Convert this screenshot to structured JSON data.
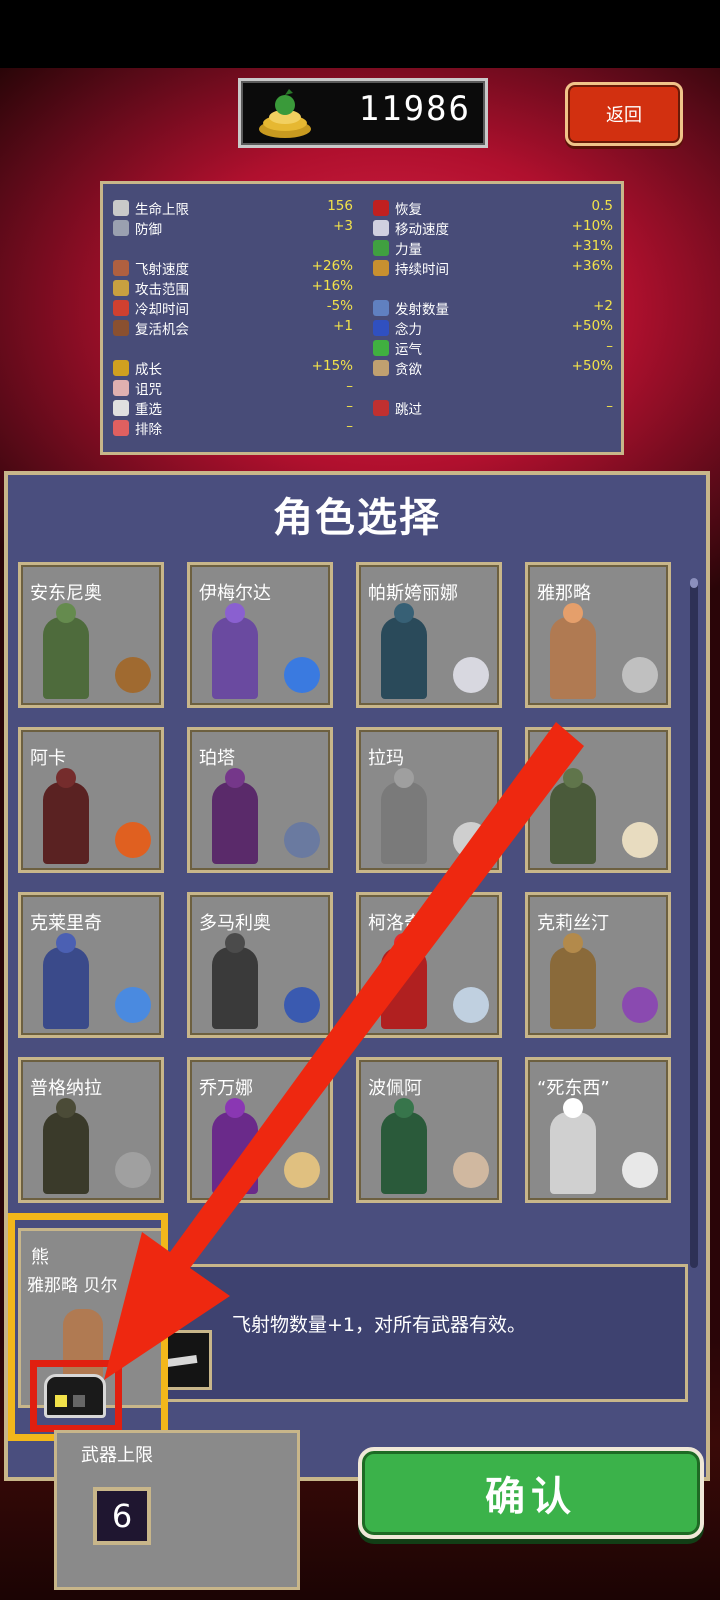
{
  "header": {
    "coins": "11986",
    "back_label": "返回"
  },
  "stats": {
    "left": [
      {
        "label": "生命上限",
        "value": "156",
        "icon": "heart-icon",
        "color": "#c9c9c9"
      },
      {
        "label": "防御",
        "value": "+3",
        "icon": "armor-icon",
        "color": "#9aa0b0"
      },
      {
        "label": "飞射速度",
        "value": "+26%",
        "icon": "speed-book-icon",
        "color": "#b06040"
      },
      {
        "label": "攻击范围",
        "value": "+16%",
        "icon": "area-icon",
        "color": "#c8a040"
      },
      {
        "label": "冷却时间",
        "value": "-5%",
        "icon": "cooldown-icon",
        "color": "#d04030"
      },
      {
        "label": "复活机会",
        "value": "+1",
        "icon": "revival-icon",
        "color": "#8a5030"
      },
      {
        "label": "成长",
        "value": "+15%",
        "icon": "growth-icon",
        "color": "#d0a020"
      },
      {
        "label": "诅咒",
        "value": "–",
        "icon": "curse-icon",
        "color": "#e0b0b0"
      },
      {
        "label": "重选",
        "value": "–",
        "icon": "reroll-icon",
        "color": "#e0e0e0"
      },
      {
        "label": "排除",
        "value": "–",
        "icon": "banish-icon",
        "color": "#e06060"
      }
    ],
    "right": [
      {
        "label": "恢复",
        "value": "0.5",
        "icon": "recovery-icon",
        "color": "#c02020"
      },
      {
        "label": "移动速度",
        "value": "+10%",
        "icon": "wings-icon",
        "color": "#d0d0e0"
      },
      {
        "label": "力量",
        "value": "+31%",
        "icon": "might-icon",
        "color": "#40a040"
      },
      {
        "label": "持续时间",
        "value": "+36%",
        "icon": "duration-icon",
        "color": "#c89030"
      },
      {
        "label": "发射数量",
        "value": "+2",
        "icon": "amount-icon",
        "color": "#6080c0"
      },
      {
        "label": "念力",
        "value": "+50%",
        "icon": "magnet-icon",
        "color": "#3050c0"
      },
      {
        "label": "运气",
        "value": "–",
        "icon": "clover-icon",
        "color": "#40b040"
      },
      {
        "label": "贪欲",
        "value": "+50%",
        "icon": "greed-icon",
        "color": "#c0a070"
      },
      {
        "label": "跳过",
        "value": "–",
        "icon": "skip-icon",
        "color": "#c03030"
      }
    ]
  },
  "panel": {
    "title": "角色选择"
  },
  "characters": [
    {
      "name": "安东尼奥",
      "figure": "#4e6b3c",
      "weapon": "#a06a30"
    },
    {
      "name": "伊梅尔达",
      "figure": "#6a4aa0",
      "weapon": "#3a7ae0"
    },
    {
      "name": "帕斯姱丽娜",
      "figure": "#2a4a5a",
      "weapon": "#d8d8e0"
    },
    {
      "name": "雅那略",
      "figure": "#b07a52",
      "weapon": "#c0c0c0"
    },
    {
      "name": "阿卡",
      "figure": "#5a2222",
      "weapon": "#e06020"
    },
    {
      "name": "珀塔",
      "figure": "#5a2a6a",
      "weapon": "#6a7aa0"
    },
    {
      "name": "拉玛",
      "figure": "#7a7a7a",
      "weapon": "#cfcfcf"
    },
    {
      "name": "",
      "figure": "#4a5a3a",
      "weapon": "#e8dcc0"
    },
    {
      "name": "克莱里奇",
      "figure": "#3a4a8a",
      "weapon": "#4a8ae0"
    },
    {
      "name": "多马利奥",
      "figure": "#3a3a3a",
      "weapon": "#3a5ab0"
    },
    {
      "name": "柯洛奇",
      "figure": "#b02020",
      "weapon": "#c0d0e0"
    },
    {
      "name": "克莉丝汀",
      "figure": "#8a6a3a",
      "weapon": "#8a4ab0"
    },
    {
      "name": "普格纳拉",
      "figure": "#3a3a2a",
      "weapon": "#a0a0a0"
    },
    {
      "name": "乔万娜",
      "figure": "#6a2a8a",
      "weapon": "#e0c080"
    },
    {
      "name": "波佩阿",
      "figure": "#2a5a3a",
      "weapon": "#d0b8a0"
    },
    {
      "name": "“死东西”",
      "figure": "#d0d0d0",
      "weapon": "#e8e8e8"
    }
  ],
  "selected": {
    "tag": "熊",
    "name": "雅那略  贝尔",
    "description": "飞射物数量+1，对所有武器有效。"
  },
  "bottom": {
    "limit_label": "武器上限",
    "limit_value": "6",
    "confirm_label": "确认"
  }
}
